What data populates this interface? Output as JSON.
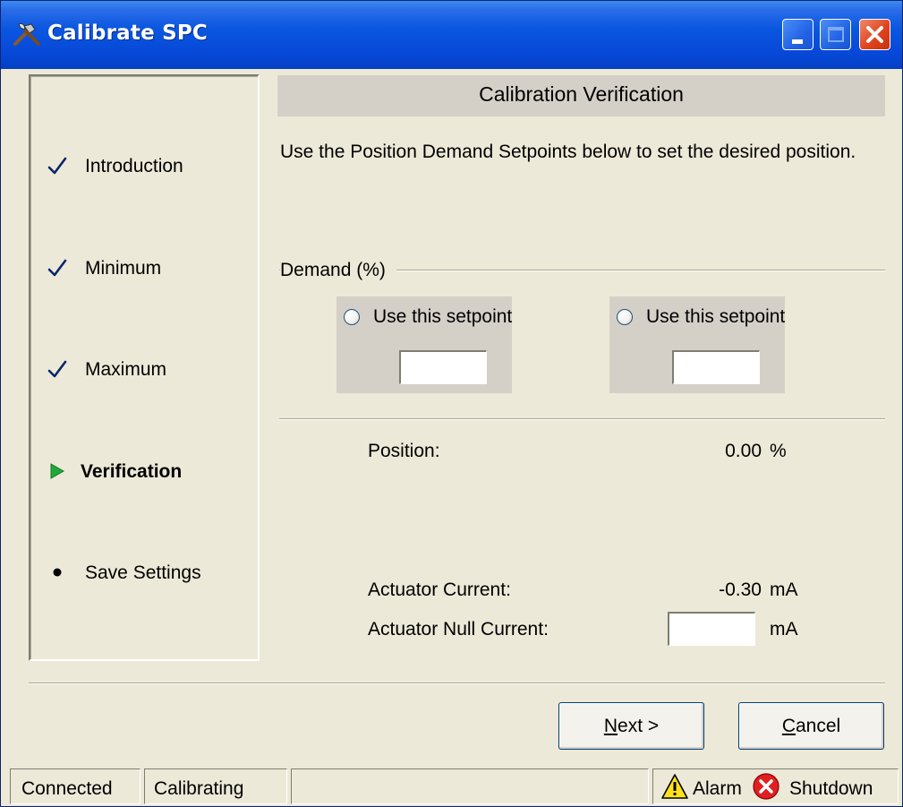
{
  "window": {
    "title": "Calibrate SPC",
    "title_icon": "tools-icon",
    "controls": [
      "minimize",
      "maximize",
      "close"
    ]
  },
  "steps": [
    {
      "label": "Introduction",
      "state": "done",
      "icon": "checkmark-icon"
    },
    {
      "label": "Minimum",
      "state": "done",
      "icon": "checkmark-icon"
    },
    {
      "label": "Maximum",
      "state": "done",
      "icon": "checkmark-icon"
    },
    {
      "label": "Verification",
      "state": "current",
      "icon": "play-arrow-icon"
    },
    {
      "label": "Save Settings",
      "state": "pending",
      "icon": "bullet-icon"
    }
  ],
  "panel": {
    "header": "Calibration Verification",
    "instruction": "Use the Position Demand Setpoints below to set the desired position."
  },
  "demand": {
    "group_label": "Demand (%)",
    "setpoints": [
      {
        "radio_label": "Use this setpoint",
        "value": ""
      },
      {
        "radio_label": "Use this setpoint",
        "value": ""
      }
    ]
  },
  "readouts": {
    "position": {
      "label": "Position:",
      "value": "0.00",
      "unit": "%"
    },
    "actuator_current": {
      "label": "Actuator Current:",
      "value": "-0.30",
      "unit": "mA"
    },
    "actuator_null_current": {
      "label": "Actuator Null Current:",
      "value": "",
      "unit": "mA"
    }
  },
  "buttons": {
    "next": {
      "label": "Next >",
      "mnemonic": "N"
    },
    "cancel": {
      "label": "Cancel",
      "mnemonic": "C"
    }
  },
  "statusbar": {
    "connection": "Connected",
    "mode": "Calibrating",
    "message": "",
    "alarm": "Alarm",
    "shutdown": "Shutdown"
  },
  "colors": {
    "titlebar": "#0a57e0",
    "face": "#ece9d8",
    "band": "#d4d0c8",
    "check": "#0a246a",
    "current_arrow": "#22a838",
    "close_button": "#e0441f",
    "alarm_yellow": "#ffe11a",
    "shutdown_red": "#e02020"
  }
}
